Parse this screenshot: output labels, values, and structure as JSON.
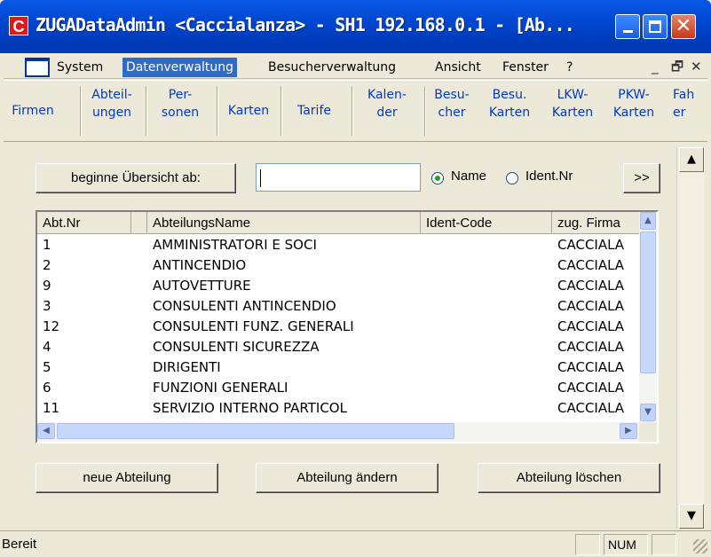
{
  "window": {
    "title": "ZUGADataAdmin <Caccialanza> - SH1 192.168.0.1 - [Ab...",
    "app_icon_letter": "C",
    "close_glyph": "✕"
  },
  "menubar": {
    "items": [
      "System",
      "Datenverwaltung",
      "Besucherverwaltung",
      "Ansicht",
      "Fenster",
      "?"
    ],
    "active": "Datenverwaltung",
    "mdi_minimize": "_",
    "mdi_restore": "🗗",
    "mdi_close": "✕"
  },
  "toolbar": {
    "items": [
      {
        "label": "Firmen"
      },
      {
        "label": "Abteil-\nungen"
      },
      {
        "label": "Per-\nsonen"
      },
      {
        "label": "Karten"
      },
      {
        "label": "Tarife"
      },
      {
        "label": "Kalen-\nder"
      },
      {
        "label": "Besu-\ncher"
      },
      {
        "label": "Besu.\nKarten"
      },
      {
        "label": "LKW-\nKarten"
      },
      {
        "label": "PKW-\nKarten"
      },
      {
        "label": "Fah\ner"
      }
    ]
  },
  "search": {
    "button_label": "beginne Übersicht ab:",
    "input_value": "",
    "radio_name_label": "Name",
    "radio_ident_label": "Ident.Nr",
    "selected": "Name",
    "next_button_label": ">>"
  },
  "list": {
    "columns": [
      "Abt.Nr",
      "AbteilungsName",
      "Ident-Code",
      "zug. Firma"
    ],
    "rows": [
      {
        "nr": "1",
        "name": "AMMINISTRATORI E SOCI",
        "ident": "",
        "firma": "CACCIALA"
      },
      {
        "nr": "2",
        "name": "ANTINCENDIO",
        "ident": "",
        "firma": "CACCIALA"
      },
      {
        "nr": "9",
        "name": "AUTOVETTURE",
        "ident": "",
        "firma": "CACCIALA"
      },
      {
        "nr": "3",
        "name": "CONSULENTI ANTINCENDIO",
        "ident": "",
        "firma": "CACCIALA"
      },
      {
        "nr": "12",
        "name": "CONSULENTI FUNZ. GENERALI",
        "ident": "",
        "firma": "CACCIALA"
      },
      {
        "nr": "4",
        "name": "CONSULENTI SICUREZZA",
        "ident": "",
        "firma": "CACCIALA"
      },
      {
        "nr": "5",
        "name": "DIRIGENTI",
        "ident": "",
        "firma": "CACCIALA"
      },
      {
        "nr": "6",
        "name": "FUNZIONI GENERALI",
        "ident": "",
        "firma": "CACCIALA"
      },
      {
        "nr": "11",
        "name": "SERVIZIO INTERNO PARTICOL",
        "ident": "",
        "firma": "CACCIALA"
      }
    ]
  },
  "actions": {
    "new_label": "neue Abteilung",
    "edit_label": "Abteilung ändern",
    "delete_label": "Abteilung löschen"
  },
  "statusbar": {
    "text": "Bereit",
    "num": "NUM"
  },
  "colors": {
    "title_blue": "#0047d0",
    "menu_highlight": "#316ac5",
    "toolbar_text": "#0039c5",
    "face": "#ece9d8"
  }
}
